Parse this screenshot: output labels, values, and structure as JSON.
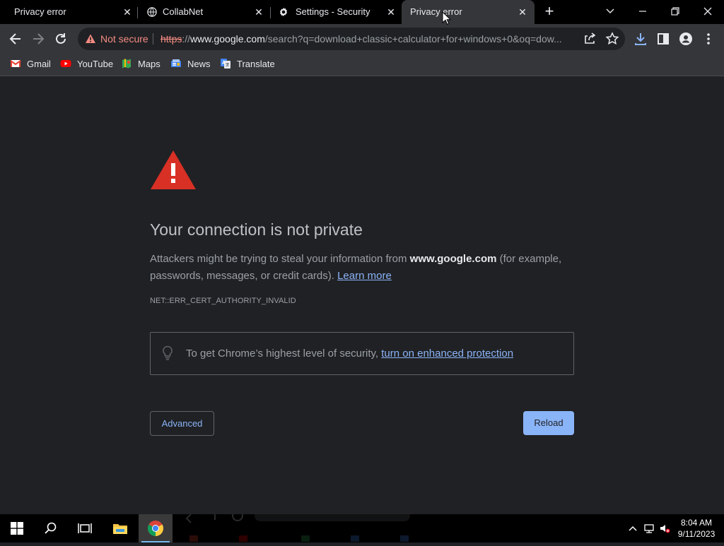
{
  "tabs": [
    {
      "title": "Privacy error",
      "active": false,
      "icon": "none"
    },
    {
      "title": "CollabNet",
      "active": false,
      "icon": "globe-icon"
    },
    {
      "title": "Settings - Security",
      "active": false,
      "icon": "gear-icon"
    },
    {
      "title": "Privacy error",
      "active": true,
      "icon": "none"
    }
  ],
  "omnibox": {
    "security_label": "Not secure",
    "url_scheme": "https",
    "url_sep": "://",
    "url_host": "www.google.com",
    "url_rest": "/search?q=download+classic+calculator+for+windows+0&oq=dow..."
  },
  "bookmarks": [
    {
      "label": "Gmail",
      "icon": "gmail-icon"
    },
    {
      "label": "YouTube",
      "icon": "youtube-icon"
    },
    {
      "label": "Maps",
      "icon": "maps-icon"
    },
    {
      "label": "News",
      "icon": "news-icon"
    },
    {
      "label": "Translate",
      "icon": "translate-icon"
    }
  ],
  "interstitial": {
    "heading": "Your connection is not private",
    "para_before": "Attackers might be trying to steal your information from ",
    "para_host": "www.google.com",
    "para_after": " (for example, passwords, messages, or credit cards). ",
    "learn_more": "Learn more",
    "error_code": "NET::ERR_CERT_AUTHORITY_INVALID",
    "security_prompt": "To get Chrome’s highest level of security, ",
    "security_link": "turn on enhanced protection",
    "advanced_label": "Advanced",
    "reload_label": "Reload"
  },
  "taskbar": {
    "time": "8:04 AM",
    "date": "9/11/2023"
  },
  "colors": {
    "accent": "#8ab4f8",
    "warning_red": "#d93025",
    "not_secure": "#f28b82",
    "page_bg": "#202124"
  }
}
